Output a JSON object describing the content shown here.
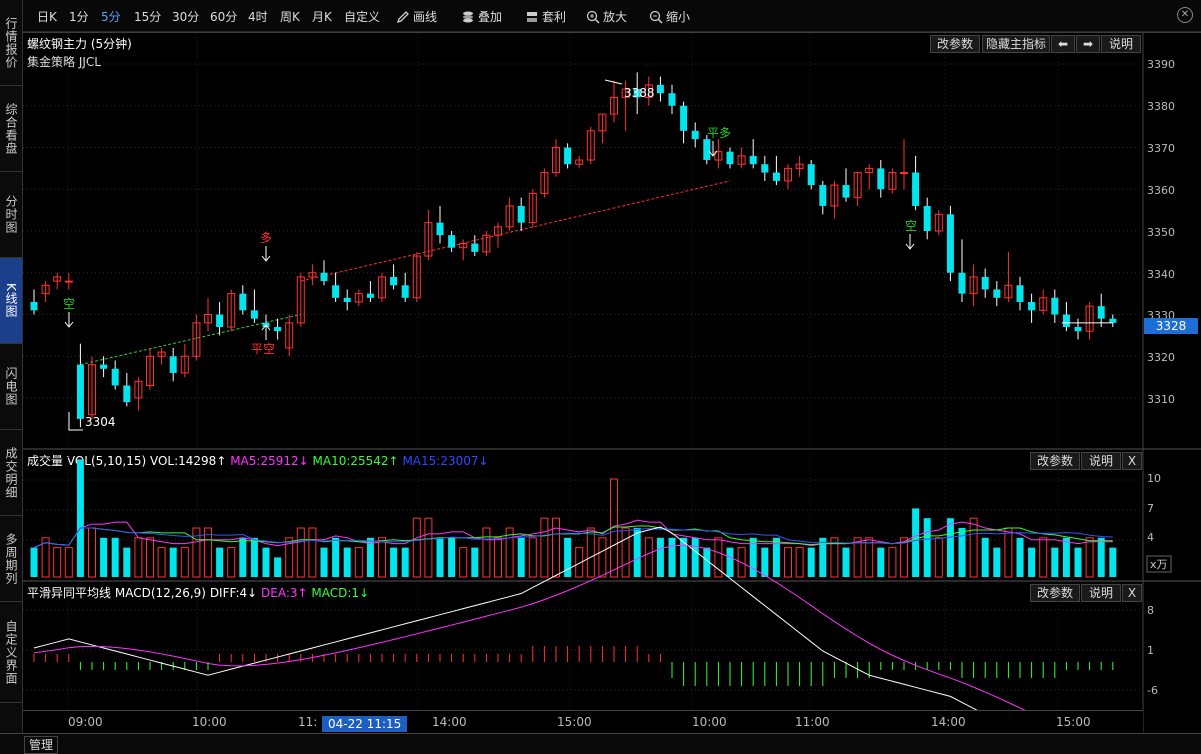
{
  "left_tabs": [
    {
      "label": "行情报价",
      "active": false
    },
    {
      "label": "综合看盘",
      "active": false
    },
    {
      "label": "分时图",
      "active": false
    },
    {
      "label": "K线图",
      "active": true
    },
    {
      "label": "闪电图",
      "active": false
    },
    {
      "label": "成交明细",
      "active": false
    },
    {
      "label": "多周期列",
      "active": false
    },
    {
      "label": "自定义界面",
      "active": false
    }
  ],
  "toolbar": {
    "periods": [
      "日K",
      "1分",
      "5分",
      "15分",
      "30分",
      "60分",
      "4时",
      "周K",
      "月K",
      "自定义"
    ],
    "active_period": "5分",
    "tools": [
      {
        "label": "画线",
        "icon": "pencil-icon"
      },
      {
        "label": "叠加",
        "icon": "stack-icon"
      },
      {
        "label": "套利",
        "icon": "arbitrage-icon"
      },
      {
        "label": "放大",
        "icon": "zoom-in-icon"
      },
      {
        "label": "缩小",
        "icon": "zoom-out-icon"
      }
    ]
  },
  "main_panel": {
    "title": "螺纹钢主力 (5分钟)",
    "strategy": "集金策略 JJCL",
    "buttons": {
      "params": "改参数",
      "hide": "隐藏主指标",
      "explain": "说明"
    },
    "price_labels": [
      "3390",
      "3380",
      "3370",
      "3360",
      "3350",
      "3340",
      "3330",
      "3320",
      "3310"
    ],
    "last_price": "3328",
    "high_label": "3388",
    "low_label": "3304",
    "signals": [
      {
        "text": "空",
        "color": "#22cc22"
      },
      {
        "text": "多",
        "color": "#ff3030"
      },
      {
        "text": "平空",
        "color": "#ff3030"
      },
      {
        "text": "平多",
        "color": "#22cc22"
      },
      {
        "text": "空",
        "color": "#22cc22"
      }
    ]
  },
  "volume_panel": {
    "title": "成交量",
    "vol_label": "VOL(5,10,15)",
    "vol_value": "VOL:14298↑",
    "ma5": "MA5:25912↓",
    "ma10": "MA10:25542↑",
    "ma15": "MA15:23007↓",
    "buttons": {
      "params": "改参数",
      "explain": "说明",
      "close": "X"
    },
    "axis_labels": [
      "10",
      "7",
      "4"
    ],
    "unit": "x万"
  },
  "macd_panel": {
    "title": "平滑异同平均线",
    "macd_label": "MACD(12,26,9)",
    "diff": "DIFF:4↓",
    "dea": "DEA:3↑",
    "macd": "MACD:1↓",
    "buttons": {
      "params": "改参数",
      "explain": "说明",
      "close": "X"
    },
    "axis_labels": [
      "8",
      "1",
      "-6"
    ]
  },
  "time_axis": {
    "labels": [
      "09:00",
      "10:00",
      "11:",
      "14:00",
      "15:00",
      "10:00",
      "11:00",
      "14:00",
      "15:00"
    ],
    "cursor": "04-22 11:15"
  },
  "bottom": {
    "manage": "管理"
  },
  "colors": {
    "up": "#ff3232",
    "down": "#00e5ee",
    "bg": "#000000",
    "accent": "#1c6fd6"
  },
  "chart_data": {
    "type": "candlestick",
    "ylim": [
      3300,
      3392
    ],
    "candles": [
      [
        3333,
        3336,
        3330,
        3331
      ],
      [
        3335,
        3338,
        3333,
        3337
      ],
      [
        3338,
        3340,
        3336,
        3339
      ],
      [
        3338,
        3340,
        3336,
        3338
      ],
      [
        3318,
        3323,
        3303,
        3305
      ],
      [
        3306,
        3320,
        3305,
        3318
      ],
      [
        3318,
        3320,
        3315,
        3317
      ],
      [
        3317,
        3319,
        3312,
        3313
      ],
      [
        3313,
        3316,
        3308,
        3309
      ],
      [
        3310,
        3315,
        3307,
        3314
      ],
      [
        3313,
        3322,
        3312,
        3320
      ],
      [
        3320,
        3322,
        3318,
        3321
      ],
      [
        3320,
        3322,
        3314,
        3316
      ],
      [
        3316,
        3323,
        3315,
        3320
      ],
      [
        3320,
        3330,
        3319,
        3328
      ],
      [
        3328,
        3334,
        3326,
        3330
      ],
      [
        3330,
        3333,
        3325,
        3327
      ],
      [
        3327,
        3336,
        3326,
        3335
      ],
      [
        3335,
        3337,
        3330,
        3331
      ],
      [
        3331,
        3336,
        3328,
        3329
      ],
      [
        3328,
        3330,
        3325,
        3327
      ],
      [
        3327,
        3329,
        3324,
        3326
      ],
      [
        3322,
        3330,
        3320,
        3328
      ],
      [
        3328,
        3340,
        3327,
        3339
      ],
      [
        3339,
        3342,
        3337,
        3340
      ],
      [
        3340,
        3343,
        3337,
        3338
      ],
      [
        3337,
        3340,
        3333,
        3334
      ],
      [
        3334,
        3336,
        3331,
        3333
      ],
      [
        3333,
        3336,
        3332,
        3335
      ],
      [
        3335,
        3338,
        3333,
        3334
      ],
      [
        3334,
        3340,
        3333,
        3339
      ],
      [
        3339,
        3342,
        3336,
        3337
      ],
      [
        3337,
        3340,
        3333,
        3334
      ],
      [
        3334,
        3345,
        3333,
        3344
      ],
      [
        3344,
        3355,
        3343,
        3352
      ],
      [
        3352,
        3356,
        3347,
        3349
      ],
      [
        3349,
        3350,
        3345,
        3346
      ],
      [
        3346,
        3348,
        3343,
        3347
      ],
      [
        3347,
        3349,
        3344,
        3345
      ],
      [
        3345,
        3350,
        3344,
        3349
      ],
      [
        3349,
        3352,
        3346,
        3351
      ],
      [
        3351,
        3358,
        3350,
        3356
      ],
      [
        3356,
        3358,
        3350,
        3352
      ],
      [
        3352,
        3360,
        3351,
        3359
      ],
      [
        3359,
        3365,
        3358,
        3364
      ],
      [
        3364,
        3372,
        3363,
        3370
      ],
      [
        3370,
        3371,
        3365,
        3366
      ],
      [
        3366,
        3368,
        3365,
        3367
      ],
      [
        3367,
        3375,
        3366,
        3374
      ],
      [
        3374,
        3378,
        3371,
        3378
      ],
      [
        3378,
        3386,
        3376,
        3382
      ],
      [
        3382,
        3386,
        3374,
        3384
      ],
      [
        3384,
        3388,
        3378,
        3382
      ],
      [
        3382,
        3387,
        3380,
        3385
      ],
      [
        3385,
        3387,
        3381,
        3383
      ],
      [
        3383,
        3385,
        3378,
        3380
      ],
      [
        3380,
        3381,
        3371,
        3374
      ],
      [
        3374,
        3376,
        3370,
        3372
      ],
      [
        3372,
        3373,
        3366,
        3367
      ],
      [
        3367,
        3372,
        3365,
        3369
      ],
      [
        3369,
        3370,
        3365,
        3366
      ],
      [
        3366,
        3370,
        3365,
        3368
      ],
      [
        3368,
        3372,
        3365,
        3366
      ],
      [
        3366,
        3368,
        3362,
        3364
      ],
      [
        3364,
        3368,
        3361,
        3362
      ],
      [
        3362,
        3366,
        3360,
        3365
      ],
      [
        3365,
        3368,
        3363,
        3366
      ],
      [
        3366,
        3367,
        3360,
        3361
      ],
      [
        3361,
        3362,
        3354,
        3356
      ],
      [
        3356,
        3362,
        3353,
        3361
      ],
      [
        3361,
        3365,
        3357,
        3358
      ],
      [
        3358,
        3364,
        3356,
        3364
      ],
      [
        3364,
        3366,
        3360,
        3365
      ],
      [
        3365,
        3367,
        3358,
        3360
      ],
      [
        3360,
        3365,
        3359,
        3364
      ],
      [
        3364,
        3372,
        3360,
        3364
      ],
      [
        3364,
        3368,
        3355,
        3356
      ],
      [
        3356,
        3358,
        3348,
        3350
      ],
      [
        3350,
        3355,
        3349,
        3354
      ],
      [
        3354,
        3356,
        3338,
        3340
      ],
      [
        3340,
        3348,
        3333,
        3335
      ],
      [
        3335,
        3342,
        3332,
        3339
      ],
      [
        3339,
        3341,
        3334,
        3336
      ],
      [
        3336,
        3338,
        3332,
        3334
      ],
      [
        3334,
        3345,
        3333,
        3337
      ],
      [
        3337,
        3339,
        3331,
        3333
      ],
      [
        3333,
        3335,
        3328,
        3331
      ],
      [
        3331,
        3336,
        3330,
        3334
      ],
      [
        3334,
        3336,
        3328,
        3330
      ],
      [
        3330,
        3333,
        3326,
        3327
      ],
      [
        3327,
        3329,
        3324,
        3326
      ],
      [
        3326,
        3333,
        3324,
        3332
      ],
      [
        3332,
        3335,
        3327,
        3329
      ],
      [
        3329,
        3330,
        3327,
        3328
      ]
    ],
    "volume": [
      3,
      4,
      3,
      3,
      12,
      5,
      4,
      4,
      3,
      4,
      4,
      3,
      3,
      3,
      5,
      5,
      3,
      3,
      4,
      4,
      3,
      2,
      4,
      5,
      5,
      3,
      4,
      3,
      3,
      4,
      4,
      3,
      3,
      6,
      6,
      4,
      4,
      3,
      3,
      5,
      4,
      5,
      4,
      4,
      6,
      6,
      4,
      3,
      5,
      4,
      10,
      5,
      5,
      4,
      4,
      4,
      4,
      4,
      3,
      4,
      3,
      3,
      4,
      3,
      4,
      3,
      3,
      3,
      4,
      4,
      3,
      4,
      4,
      3,
      3,
      4,
      7,
      6,
      4,
      6,
      5,
      6,
      4,
      3,
      5,
      4,
      3,
      4,
      3,
      4,
      3,
      4,
      4,
      3
    ],
    "macd_hist": [
      1,
      1,
      1,
      1,
      -1,
      -1,
      -1,
      -1,
      -1,
      -1,
      -1,
      -1,
      -1,
      -1,
      -1,
      -1,
      1,
      1,
      1,
      1,
      1,
      1,
      1,
      1,
      1,
      1,
      1,
      1,
      1,
      1,
      1,
      1,
      1,
      1,
      1,
      1,
      1,
      1,
      1,
      1,
      1,
      1,
      1,
      2,
      2,
      2,
      2,
      2,
      2,
      2,
      2,
      2,
      2,
      1,
      1,
      -2,
      -3,
      -3,
      -3,
      -3,
      -3,
      -3,
      -3,
      -3,
      -3,
      -3,
      -3,
      -3,
      -3,
      -2,
      -2,
      -2,
      -2,
      -1,
      -1,
      -1,
      -1,
      -1,
      -1,
      -1,
      -2,
      -2,
      -2,
      -2,
      -2,
      -2,
      -2,
      -2,
      -2,
      -1,
      -1,
      -1,
      -1,
      -1
    ]
  }
}
